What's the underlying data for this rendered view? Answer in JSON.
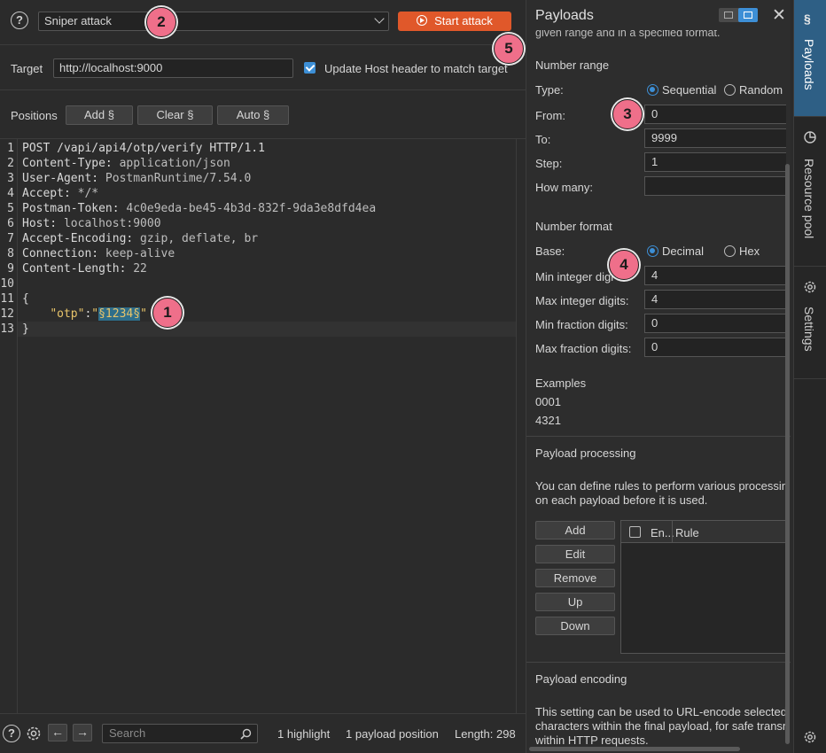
{
  "attack": {
    "help_glyph": "?",
    "type_selected": "Sniper attack",
    "start_label": "Start attack"
  },
  "badges": [
    "1",
    "2",
    "3",
    "4",
    "5"
  ],
  "target": {
    "label": "Target",
    "value": "http://localhost:9000",
    "update_host_label": "Update Host header to match target",
    "update_host_checked": true
  },
  "positions": {
    "label": "Positions",
    "add_label": "Add §",
    "clear_label": "Clear §",
    "auto_label": "Auto §"
  },
  "editor": {
    "lines": [
      {
        "n": "1",
        "text": "POST /vapi/api4/otp/verify HTTP/1.1"
      },
      {
        "n": "2",
        "key": "Content-Type:",
        "val": " application/json"
      },
      {
        "n": "3",
        "key": "User-Agent:",
        "val": " PostmanRuntime/7.54.0"
      },
      {
        "n": "4",
        "key": "Accept:",
        "val": " */*"
      },
      {
        "n": "5",
        "key": "Postman-Token:",
        "val": " 4c0e9eda-be45-4b3d-832f-9da3e8dfd4ea"
      },
      {
        "n": "6",
        "key": "Host:",
        "val": " localhost:9000"
      },
      {
        "n": "7",
        "key": "Accept-Encoding:",
        "val": " gzip, deflate, br"
      },
      {
        "n": "8",
        "key": "Connection:",
        "val": " keep-alive"
      },
      {
        "n": "9",
        "key": "Content-Length:",
        "val": " 22"
      },
      {
        "n": "10",
        "text": ""
      },
      {
        "n": "11",
        "text": "{"
      },
      {
        "n": "12",
        "otp_key": "\"otp\"",
        "colon": ":",
        "quote_open": "\"",
        "payload": "§1234§",
        "quote_close": "\""
      },
      {
        "n": "13",
        "text": "}"
      }
    ]
  },
  "footer": {
    "search_placeholder": "Search",
    "highlight_count": "1 highlight",
    "payload_positions": "1 payload position",
    "length": "Length: 298"
  },
  "payloads": {
    "title": "Payloads",
    "intro_tail": "given range and in a specified format.",
    "number_range_heading": "Number range",
    "type_label": "Type:",
    "type_options": [
      "Sequential",
      "Random"
    ],
    "type_selected": "Sequential",
    "from_label": "From:",
    "from_value": "0",
    "to_label": "To:",
    "to_value": "9999",
    "step_label": "Step:",
    "step_value": "1",
    "how_many_label": "How many:",
    "how_many_value": "",
    "number_format_heading": "Number format",
    "base_label": "Base:",
    "base_options": [
      "Decimal",
      "Hex"
    ],
    "base_selected": "Decimal",
    "min_int_label": "Min integer digi",
    "min_int_value": "4",
    "max_int_label": "Max integer digits:",
    "max_int_value": "4",
    "min_frac_label": "Min fraction digits:",
    "min_frac_value": "0",
    "max_frac_label": "Max fraction digits:",
    "max_frac_value": "0",
    "examples_heading": "Examples",
    "examples": [
      "0001",
      "4321"
    ],
    "processing_heading": "Payload processing",
    "processing_desc_1": "You can define rules to perform various processin",
    "processing_desc_2": "on each payload before it is used.",
    "rule_buttons": [
      "Add",
      "Edit",
      "Remove",
      "Up",
      "Down"
    ],
    "table_col_enabled": "En...",
    "table_col_rule": "Rule",
    "encoding_heading": "Payload encoding",
    "encoding_desc_1": "This setting can be used to URL-encode selected",
    "encoding_desc_2": "characters within the final payload, for safe transn",
    "encoding_desc_3": "within HTTP requests."
  },
  "side_tabs": {
    "payloads_label": "Payloads",
    "resource_pool_label": "Resource pool",
    "settings_label": "Settings"
  },
  "colors": {
    "accent_orange": "#e0582a",
    "accent_blue": "#3d8fd6",
    "badge_pink": "#ef6f8a",
    "highlight": "#2f6e8a"
  }
}
